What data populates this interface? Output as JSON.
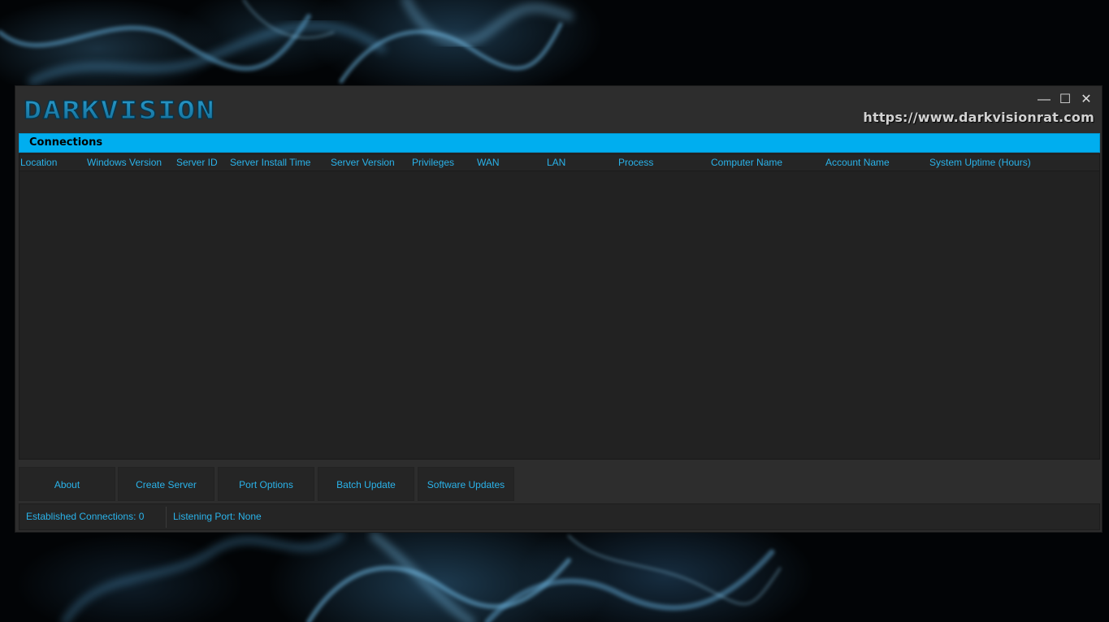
{
  "window": {
    "logo_text": "DARKVISION",
    "site_url": "https://www.darkvisionrat.com",
    "controls": {
      "minimize": "—",
      "maximize": "☐",
      "close": "✕"
    }
  },
  "connections_panel": {
    "title": "Connections",
    "columns": [
      "Location",
      "Windows Version",
      "Server ID",
      "Server Install Time",
      "Server Version",
      "Privileges",
      "WAN",
      "LAN",
      "Process",
      "Computer Name",
      "Account Name",
      "System Uptime (Hours)"
    ],
    "rows": []
  },
  "buttons": [
    "About",
    "Create Server",
    "Port Options",
    "Batch Update",
    "Software Updates"
  ],
  "status": {
    "established_connections": "Established Connections: 0",
    "listening_port": "Listening Port: None"
  },
  "colors": {
    "accent": "#00aeef",
    "text_accent": "#2ab3ea",
    "window_bg": "#2d2d2d",
    "list_bg": "#222222"
  },
  "icons": [
    "minimize-icon",
    "maximize-icon",
    "close-icon"
  ]
}
